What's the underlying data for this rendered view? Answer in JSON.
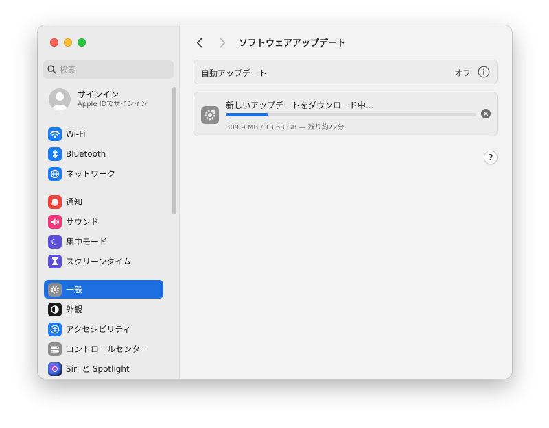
{
  "window": {
    "title": "ソフトウェアアップデート"
  },
  "sidebar": {
    "search": {
      "placeholder": "検索"
    },
    "account": {
      "title": "サインイン",
      "subtitle": "Apple IDでサインイン"
    },
    "items": [
      {
        "label": "Wi-Fi",
        "icon": "wifi-icon",
        "color": "#1c7cf2"
      },
      {
        "label": "Bluetooth",
        "icon": "bluetooth-icon",
        "color": "#1c7cf2"
      },
      {
        "label": "ネットワーク",
        "icon": "globe-icon",
        "color": "#1c7cf2"
      },
      {
        "label": "通知",
        "icon": "bell-icon",
        "color": "#f0443a"
      },
      {
        "label": "サウンド",
        "icon": "speaker-icon",
        "color": "#f0397a"
      },
      {
        "label": "集中モード",
        "icon": "moon-icon",
        "color": "#5a4fd6"
      },
      {
        "label": "スクリーンタイム",
        "icon": "hourglass-icon",
        "color": "#5a4fd6"
      },
      {
        "label": "一般",
        "icon": "gear-icon",
        "color": "#8e8e8e",
        "selected": true
      },
      {
        "label": "外観",
        "icon": "appearance-icon",
        "color": "#1a1a1a"
      },
      {
        "label": "アクセシビリティ",
        "icon": "accessibility-icon",
        "color": "#1c7cf2"
      },
      {
        "label": "コントロールセンター",
        "icon": "control-center-icon",
        "color": "#8e8e8e"
      },
      {
        "label": "Siri と Spotlight",
        "icon": "siri-icon",
        "color": "#2b2b6e"
      }
    ]
  },
  "main": {
    "auto_update": {
      "label": "自動アップデート",
      "value": "オフ"
    },
    "update": {
      "title": "新しいアップデートをダウンロード中...",
      "status": "309.9 MB / 13.63 GB — 残り約22分",
      "progress": 0.17
    },
    "help": "?"
  }
}
